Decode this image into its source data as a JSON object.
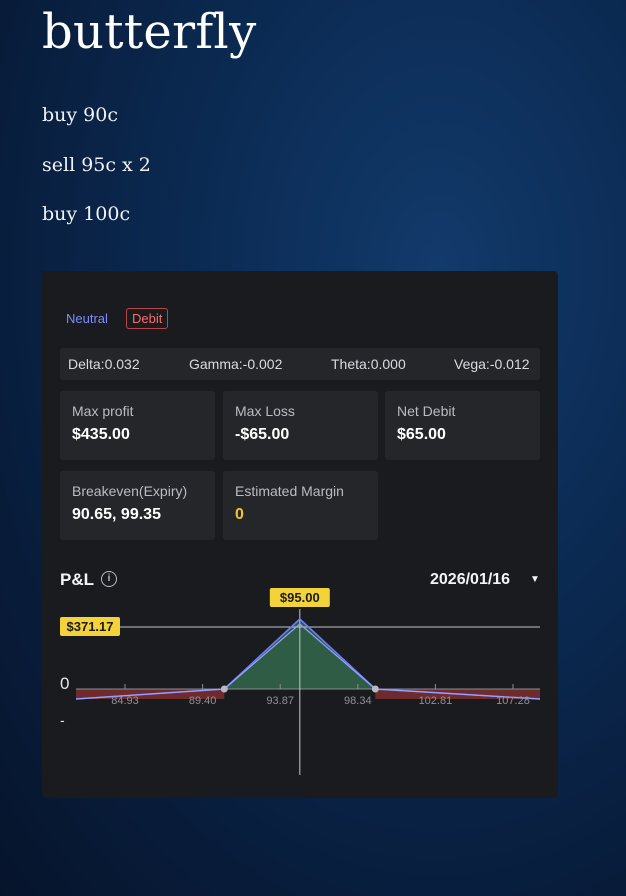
{
  "slide": {
    "title": "butterfly",
    "legs": [
      "buy 90c",
      "sell  95c x 2",
      "buy 100c"
    ]
  },
  "strategy": {
    "tags": {
      "neutral": "Neutral",
      "debit": "Debit"
    },
    "greeks": {
      "delta": "Delta:0.032",
      "gamma": "Gamma:-0.002",
      "theta": "Theta:0.000",
      "vega": "Vega:-0.012"
    },
    "cards": {
      "max_profit": {
        "label": "Max profit",
        "value": "$435.00"
      },
      "max_loss": {
        "label": "Max Loss",
        "value": "-$65.00"
      },
      "net_debit": {
        "label": "Net Debit",
        "value": "$65.00"
      },
      "breakeven": {
        "label": "Breakeven(Expiry)",
        "value": "90.65, 99.35"
      },
      "margin": {
        "label": "Estimated Margin",
        "value": "0"
      }
    },
    "pnl": {
      "label": "P&L",
      "info_icon": "info-icon",
      "date": "2026/01/16",
      "caret_icon": "caret-down-icon"
    }
  },
  "chart_data": {
    "type": "line",
    "title": "",
    "xlabel": "",
    "ylabel": "",
    "x_ticks": [
      "84.93",
      "89.40",
      "93.87",
      "98.34",
      "102.81",
      "107.28"
    ],
    "y_ticks": [
      "+",
      "0",
      "-"
    ],
    "price_marker": "$95.00",
    "value_marker": "$371.17",
    "series": [
      {
        "color": "#6c7cff",
        "x": [
          80.5,
          90.65,
          95.0,
          99.35,
          109.5
        ],
        "y": [
          -65,
          0,
          435,
          0,
          -65
        ]
      },
      {
        "color": "#9aa0ff",
        "x": [
          80.5,
          90.65,
          95.0,
          99.35,
          109.5
        ],
        "y": [
          -40,
          0,
          371.17,
          0,
          -40
        ]
      }
    ],
    "colors": {
      "profit_fill": "#2f5c45",
      "loss_fill": "#6e2b2b"
    }
  }
}
